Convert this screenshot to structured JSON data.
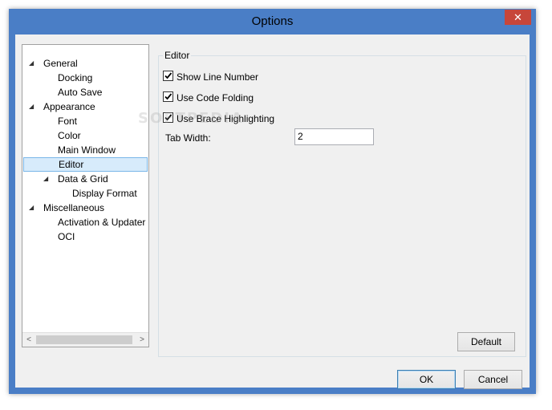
{
  "window": {
    "title": "Options",
    "close_glyph": "✕"
  },
  "tree": {
    "items": [
      {
        "label": "General",
        "level": 0,
        "expanded": true
      },
      {
        "label": "Docking",
        "level": 1
      },
      {
        "label": "Auto Save",
        "level": 1
      },
      {
        "label": "Appearance",
        "level": 0,
        "expanded": true
      },
      {
        "label": "Font",
        "level": 1
      },
      {
        "label": "Color",
        "level": 1
      },
      {
        "label": "Main Window",
        "level": 1
      },
      {
        "label": "Editor",
        "level": 1,
        "selected": true
      },
      {
        "label": "Data & Grid",
        "level": 1,
        "expanded": true
      },
      {
        "label": "Display Format",
        "level": 2
      },
      {
        "label": "Miscellaneous",
        "level": 0,
        "expanded": true
      },
      {
        "label": "Activation & Updater",
        "level": 1
      },
      {
        "label": "OCI",
        "level": 1
      }
    ],
    "expander_glyph": "◢",
    "scroll_left_glyph": "<",
    "scroll_right_glyph": ">"
  },
  "editor": {
    "group_title": "Editor",
    "show_line_number": {
      "label": "Show Line Number",
      "checked": true
    },
    "use_code_folding": {
      "label": "Use Code Folding",
      "checked": true
    },
    "use_brace_highlighting": {
      "label": "Use Brace Highlighting",
      "checked": true
    },
    "tab_width_label": "Tab Width:",
    "tab_width_value": "2",
    "default_button": "Default"
  },
  "footer": {
    "ok_button": "OK",
    "cancel_button": "Cancel"
  },
  "watermark": "SOFTPEDIA",
  "colors": {
    "window_frame": "#4a7ec6",
    "close_button": "#c7463a",
    "selection_fill": "#d7ebfb",
    "selection_border": "#7ab7e8"
  }
}
